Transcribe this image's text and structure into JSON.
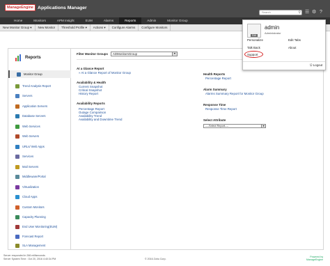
{
  "header": {
    "logo_badge": "ManageEngine",
    "app_title": "Applications Manager",
    "search_placeholder": "Search",
    "icons": [
      "menu-icon",
      "settings-icon",
      "help-icon",
      "user-icon"
    ]
  },
  "nav": {
    "tabs": [
      "Home",
      "Monitors",
      "APM Insight",
      "EUM",
      "Alarms",
      "Reports",
      "Admin",
      "Monitor Group"
    ],
    "active": "Reports"
  },
  "subnav": {
    "items": [
      "New Monitor Group ▾",
      "New Monitor",
      "Threshold Profile ▾",
      "Actions ▾",
      "Configure Alarms",
      "Configure Monitors"
    ]
  },
  "sidebar": {
    "title": "Reports",
    "items": [
      {
        "label": "Monitor Group",
        "color": "#3a6ea5"
      },
      {
        "label": "Trend Analysis Report",
        "color": "#7a9a3a"
      },
      {
        "label": "Servers",
        "color": "#4a80c0"
      },
      {
        "label": "Application Servers",
        "color": "#c06a20"
      },
      {
        "label": "Database Servers",
        "color": "#2a7ab0"
      },
      {
        "label": "Web Services",
        "color": "#3f9a3f"
      },
      {
        "label": "Web Servers",
        "color": "#b04a2a"
      },
      {
        "label": "URLs/ Web Apps",
        "color": "#2f7fc1"
      },
      {
        "label": "Services",
        "color": "#6a6aa0"
      },
      {
        "label": "Mail Servers",
        "color": "#c09a20"
      },
      {
        "label": "Middleware/Portal",
        "color": "#5a8a9a"
      },
      {
        "label": "Virtualization",
        "color": "#7a3aa0"
      },
      {
        "label": "Cloud Apps",
        "color": "#2a90d0"
      },
      {
        "label": "Custom Monitors",
        "color": "#d0602a"
      },
      {
        "label": "Capacity Planning",
        "color": "#3a8a5a"
      },
      {
        "label": "End User Monitoring(EUM)",
        "color": "#a03a3a"
      },
      {
        "label": "Forecast Report",
        "color": "#4a6ac0"
      },
      {
        "label": "SLA Management",
        "color": "#8a8a2a"
      }
    ]
  },
  "filter": {
    "label": "Filter Monitor Groups",
    "value": "ADMonitorsGroup"
  },
  "left_sections": [
    {
      "heading": "At a Glance Report",
      "links": [
        "» At a Glance Report of Monitor Group"
      ]
    },
    {
      "heading": "Availability & Health",
      "links": [
        "Current Snapshot",
        "Critical Snapshot",
        "History Report"
      ]
    },
    {
      "heading": "Availability Reports",
      "links": [
        "Percentage Report",
        "Outage Comparison",
        "Availability Trend",
        "Availability and Downtime Trend"
      ]
    }
  ],
  "right_sections": [
    {
      "heading": "Health Reports",
      "links": [
        "Percentage Report"
      ]
    },
    {
      "heading": "Alarm Summary",
      "links": [
        "Alarms Summary Report for Monitor Group"
      ]
    },
    {
      "heading": "Response Time",
      "links": [
        "Response Time Report"
      ]
    }
  ],
  "select_attribute": {
    "label": "Select Attribute",
    "value": "----Select Report----"
  },
  "user_menu": {
    "username": "admin",
    "role": "Administrator",
    "avatar_edit": "Edit",
    "links_left": [
      "Personalize",
      "Talk Back",
      "Support"
    ],
    "links_right": [
      "Edit Tabs",
      "About"
    ],
    "logout": "Logout",
    "highlight_color": "#d42020"
  },
  "footer": {
    "line1": "Server responded in 266 milliseconds",
    "line2": "Server System Time : Oct 20, 2016 4:40:34 PM",
    "copyright": "© 2016 Zoho Corp.",
    "powered_by": "Powered by",
    "powered_brand": "ManageEngine"
  }
}
